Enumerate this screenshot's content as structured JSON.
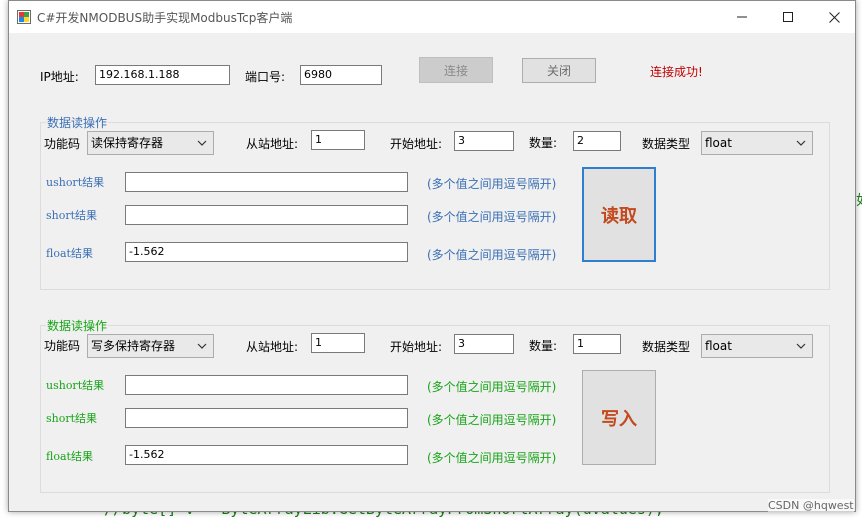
{
  "window": {
    "title": "C#开发NMODBUS助手实现ModbusTcp客户端"
  },
  "colors": {
    "success": "#c00000",
    "read_label": "#3a6fb5",
    "write_label": "#17a417",
    "big_button_text": "#c24a1e"
  },
  "connection": {
    "ip_label": "IP地址:",
    "ip_value": "192.168.1.188",
    "port_label": "端口号:",
    "port_value": "6980",
    "connect_label": "连接",
    "close_label": "关闭",
    "status": "连接成功!"
  },
  "read_group": {
    "title": "数据读操作",
    "function_label": "功能码",
    "function_value": "读保持寄存器",
    "slave_label": "从站地址:",
    "slave_value": "1",
    "start_label": "开始地址:",
    "start_value": "3",
    "count_label": "数量:",
    "count_value": "2",
    "type_label": "数据类型",
    "type_value": "float",
    "ushort_label": "ushort结果",
    "ushort_value": "",
    "short_label": "short结果",
    "short_value": "",
    "float_label": "float结果",
    "float_value": "-1.562",
    "hint": "(多个值之间用逗号隔开)",
    "button": "读取"
  },
  "write_group": {
    "title": "数据读操作",
    "function_label": "功能码",
    "function_value": "写多保持寄存器",
    "slave_label": "从站地址:",
    "slave_value": "1",
    "start_label": "开始地址:",
    "start_value": "3",
    "count_label": "数量:",
    "count_value": "1",
    "type_label": "数据类型",
    "type_value": "float",
    "ushort_label": "ushort结果",
    "ushort_value": "",
    "short_label": "short结果",
    "short_value": "",
    "float_label": "float结果",
    "float_value": "-1.562",
    "hint": "(多个值之间用逗号隔开)",
    "button": "写入"
  },
  "background": {
    "code_line": "//byte[] v = ByteArrayLib.GetByteArrayFromShortArray(uValues);",
    "side_char": "如",
    "watermark": "CSDN @hqwest"
  }
}
